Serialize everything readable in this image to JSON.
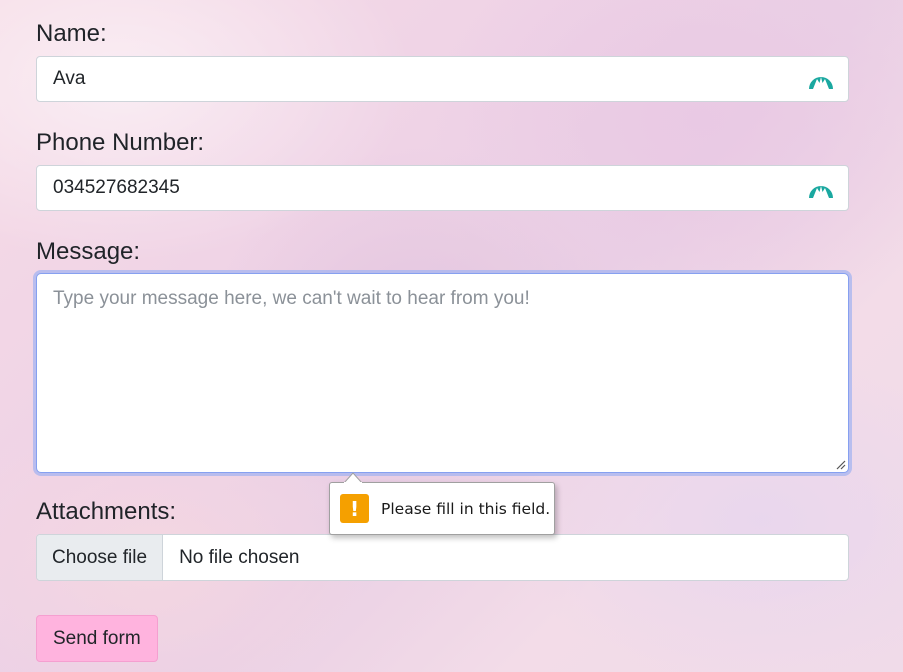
{
  "form": {
    "name": {
      "label": "Name:",
      "value": "Ava",
      "autofill_icon": "autofill-mountain-icon"
    },
    "phone": {
      "label": "Phone Number:",
      "value": "034527682345",
      "autofill_icon": "autofill-mountain-icon"
    },
    "message": {
      "label": "Message:",
      "placeholder": "Type your message here, we can't wait to hear from you!",
      "value": ""
    },
    "attachments": {
      "label": "Attachments:",
      "button_label": "Choose file",
      "status": "No file chosen"
    },
    "submit_label": "Send form"
  },
  "validation_tooltip": {
    "icon": "warning-icon",
    "icon_glyph": "!",
    "text": "Please fill in this field."
  },
  "colors": {
    "autofill_icon": "#1aa8a0",
    "focus_ring": "#a5b4f0",
    "submit_bg": "#ffb3de",
    "warning": "#f5a000"
  }
}
